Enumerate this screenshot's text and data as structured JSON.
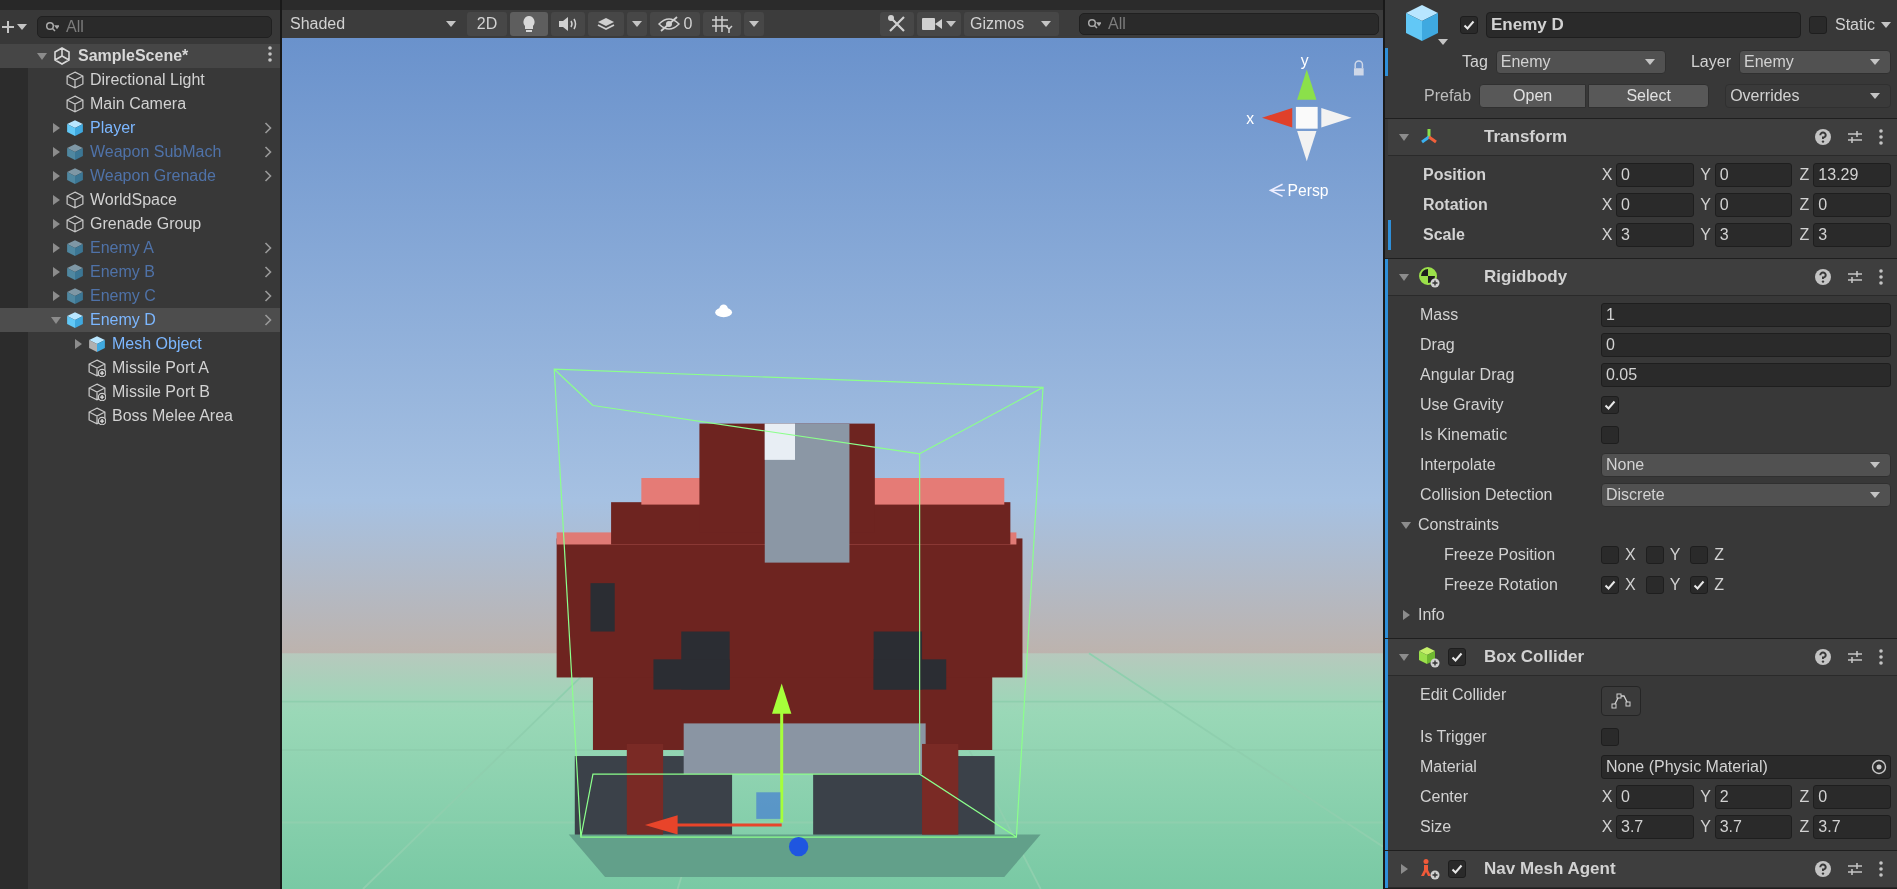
{
  "hierarchy": {
    "search": {
      "placeholder": "All"
    },
    "scene": {
      "name": "SampleScene*",
      "expanded": true,
      "children": [
        {
          "name": "Directional Light",
          "kind": "object",
          "active": true,
          "selected": false
        },
        {
          "name": "Main Camera",
          "kind": "object",
          "active": true,
          "selected": false
        },
        {
          "name": "Player",
          "kind": "prefab",
          "active": true,
          "selected": false,
          "expanded": false
        },
        {
          "name": "Weapon SubMach",
          "kind": "prefab",
          "active": false,
          "selected": false,
          "expanded": false
        },
        {
          "name": "Weapon Grenade",
          "kind": "prefab",
          "active": false,
          "selected": false,
          "expanded": false
        },
        {
          "name": "WorldSpace",
          "kind": "object",
          "active": true,
          "selected": false,
          "expanded": false
        },
        {
          "name": "Grenade Group",
          "kind": "object",
          "active": true,
          "selected": false,
          "expanded": false
        },
        {
          "name": "Enemy A",
          "kind": "prefab",
          "active": false,
          "selected": false,
          "expanded": false
        },
        {
          "name": "Enemy B",
          "kind": "prefab",
          "active": false,
          "selected": false,
          "expanded": false
        },
        {
          "name": "Enemy C",
          "kind": "prefab",
          "active": false,
          "selected": false,
          "expanded": false
        },
        {
          "name": "Enemy D",
          "kind": "prefab",
          "active": true,
          "selected": true,
          "expanded": true,
          "children": [
            {
              "name": "Mesh Object",
              "kind": "model",
              "active": true,
              "selected": false,
              "expanded": false
            },
            {
              "name": "Missile Port A",
              "kind": "added-object",
              "active": true,
              "selected": false
            },
            {
              "name": "Missile Port B",
              "kind": "added-object",
              "active": true,
              "selected": false
            },
            {
              "name": "Boss Melee Area",
              "kind": "added-object",
              "active": true,
              "selected": false
            }
          ]
        }
      ]
    }
  },
  "scene": {
    "toolbar": {
      "shading": "Shaded",
      "view_2d": {
        "label": "2D",
        "on": false
      },
      "lighting": {
        "on": true
      },
      "audio": {
        "on": false
      },
      "hidden": {
        "count": "0"
      },
      "gizmos": "Gizmos",
      "search": {
        "placeholder": "All"
      }
    },
    "gizmo": {
      "x_label": "x",
      "y_label": "y",
      "projection": "Persp"
    }
  },
  "inspector": {
    "header": {
      "active": true,
      "name": "Enemy D",
      "static": false,
      "static_label": "Static",
      "tag": {
        "label": "Tag",
        "value": "Enemy",
        "overridden": true
      },
      "layer": {
        "label": "Layer",
        "value": "Enemy"
      },
      "prefab": {
        "label": "Prefab",
        "buttons": [
          "Open",
          "Select"
        ],
        "overrides": "Overrides"
      }
    },
    "components": [
      {
        "title": "Transform",
        "kind": "transform",
        "expanded": true,
        "overridden": false,
        "fields": [
          {
            "label": "Position",
            "kind": "vector",
            "overridden": false,
            "values": [
              {
                "axis": "X",
                "value": "0"
              },
              {
                "axis": "Y",
                "value": "0"
              },
              {
                "axis": "Z",
                "value": "13.29"
              }
            ]
          },
          {
            "label": "Rotation",
            "kind": "vector",
            "overridden": false,
            "values": [
              {
                "axis": "X",
                "value": "0"
              },
              {
                "axis": "Y",
                "value": "0"
              },
              {
                "axis": "Z",
                "value": "0"
              }
            ]
          },
          {
            "label": "Scale",
            "kind": "vector",
            "overridden": true,
            "values": [
              {
                "axis": "X",
                "value": "3"
              },
              {
                "axis": "Y",
                "value": "3"
              },
              {
                "axis": "Z",
                "value": "3"
              }
            ]
          }
        ]
      },
      {
        "title": "Rigidbody",
        "kind": "rigidbody",
        "expanded": true,
        "overridden": true,
        "fields": [
          {
            "label": "Mass",
            "kind": "number",
            "value": "1"
          },
          {
            "label": "Drag",
            "kind": "number",
            "value": "0"
          },
          {
            "label": "Angular Drag",
            "kind": "number",
            "value": "0.05"
          },
          {
            "label": "Use Gravity",
            "kind": "checkbox",
            "checked": true
          },
          {
            "label": "Is Kinematic",
            "kind": "checkbox",
            "checked": false
          },
          {
            "label": "Interpolate",
            "kind": "dropdown",
            "value": "None"
          },
          {
            "label": "Collision Detection",
            "kind": "dropdown",
            "value": "Discrete"
          },
          {
            "label": "Constraints",
            "kind": "foldout",
            "expanded": true,
            "children": [
              {
                "label": "Freeze Position",
                "kind": "axes",
                "axes": [
                  {
                    "axis": "X",
                    "checked": false
                  },
                  {
                    "axis": "Y",
                    "checked": false
                  },
                  {
                    "axis": "Z",
                    "checked": false
                  }
                ]
              },
              {
                "label": "Freeze Rotation",
                "kind": "axes",
                "axes": [
                  {
                    "axis": "X",
                    "checked": true
                  },
                  {
                    "axis": "Y",
                    "checked": false
                  },
                  {
                    "axis": "Z",
                    "checked": true
                  }
                ]
              }
            ]
          },
          {
            "label": "Info",
            "kind": "foldout",
            "expanded": false
          }
        ]
      },
      {
        "title": "Box Collider",
        "kind": "box-collider",
        "enabled": true,
        "expanded": true,
        "overridden": true,
        "fields": [
          {
            "label": "Edit Collider",
            "kind": "edit-button"
          },
          {
            "label": "Is Trigger",
            "kind": "checkbox",
            "checked": false
          },
          {
            "label": "Material",
            "kind": "object",
            "value": "None (Physic Material)"
          },
          {
            "label": "Center",
            "kind": "vector",
            "values": [
              {
                "axis": "X",
                "value": "0"
              },
              {
                "axis": "Y",
                "value": "2"
              },
              {
                "axis": "Z",
                "value": "0"
              }
            ]
          },
          {
            "label": "Size",
            "kind": "vector",
            "values": [
              {
                "axis": "X",
                "value": "3.7"
              },
              {
                "axis": "Y",
                "value": "3.7"
              },
              {
                "axis": "Z",
                "value": "3.7"
              }
            ]
          }
        ]
      },
      {
        "title": "Nav Mesh Agent",
        "kind": "nav-mesh-agent",
        "enabled": true,
        "expanded": false,
        "overridden": true
      }
    ]
  }
}
